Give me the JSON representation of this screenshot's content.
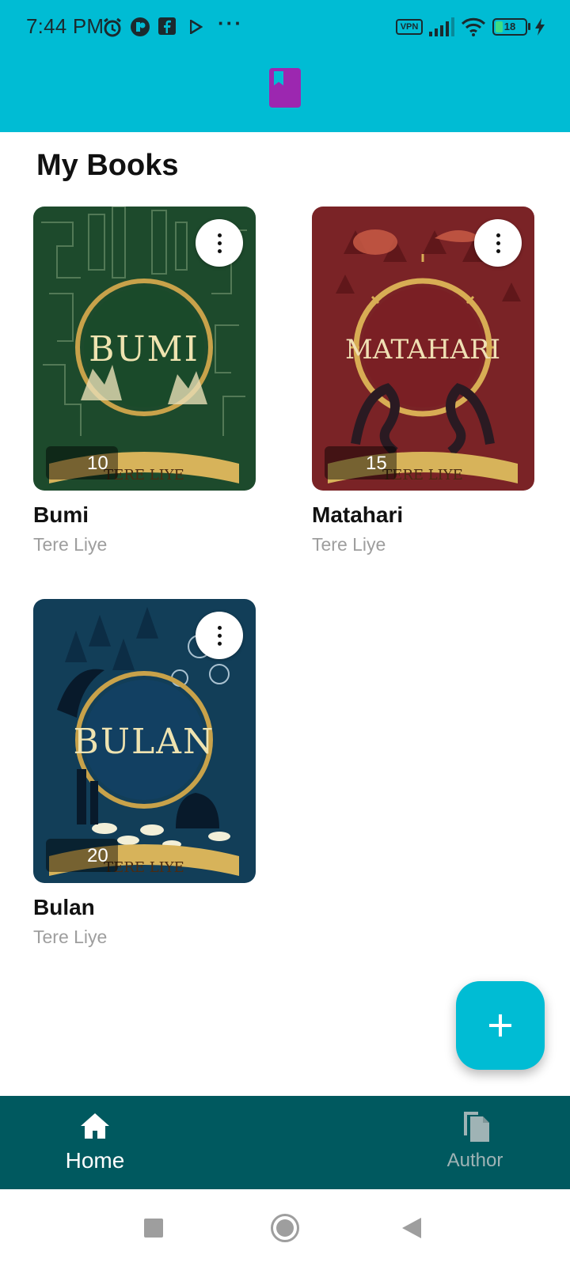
{
  "status": {
    "time": "7:44 PM",
    "vpn_label": "VPN",
    "battery_level": "18"
  },
  "appbar": {
    "logo_icon": "book-bookmark-icon"
  },
  "page": {
    "title": "My Books"
  },
  "books": [
    {
      "title": "Bumi",
      "author": "Tere Liye",
      "stock": "10",
      "cover_color": "#1d4a2c"
    },
    {
      "title": "Matahari",
      "author": "Tere Liye",
      "stock": "15",
      "cover_color": "#7a2326"
    },
    {
      "title": "Bulan",
      "author": "Tere Liye",
      "stock": "20",
      "cover_color": "#123e58"
    }
  ],
  "fab": {
    "icon": "plus-icon"
  },
  "bottom_nav": {
    "items": [
      {
        "label": "Home",
        "icon": "home-icon",
        "active": true
      },
      {
        "label": "Author",
        "icon": "copy-documents-icon",
        "active": false
      }
    ]
  },
  "colors": {
    "primary": "#00BCD4",
    "bottom_nav_bg": "#00595F",
    "logo": "#9C27B0"
  }
}
